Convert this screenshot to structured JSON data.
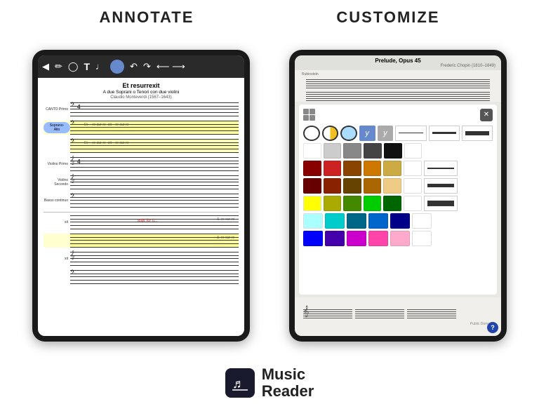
{
  "header": {
    "annotate_label": "ANNOTATE",
    "customize_label": "CUSTOMIZE"
  },
  "left_tablet": {
    "piece_title": "Et resurrexit",
    "piece_subtitle": "A due Soprani o Tenori con due violini",
    "piece_composer": "Claudio Monteverdi (1567–1643)",
    "toolbar_icons": [
      "←",
      "✏",
      "◯",
      "T",
      "♩",
      "●",
      "↶",
      "↷",
      "←→"
    ],
    "staff_rows": [
      {
        "label": "CANTO Primo",
        "highlighted": false,
        "blue_label": false
      },
      {
        "label": "Soprano-Alto",
        "highlighted": true,
        "blue_label": true
      },
      {
        "label": "",
        "highlighted": true,
        "blue_label": false
      },
      {
        "label": "Violino Primo",
        "highlighted": false,
        "blue_label": false
      },
      {
        "label": "Violino Secondo",
        "highlighted": false,
        "blue_label": false
      },
      {
        "label": "Basso continuo",
        "highlighted": false,
        "blue_label": false
      }
    ],
    "bottom_label": "wait for it...",
    "time_sig": "4/2"
  },
  "right_tablet": {
    "piece_title": "Prelude, Opus 45",
    "piece_composer": "Frederic Chopin (1810–1849)",
    "staff_label": "Rubinstein",
    "public_domain_text": "Public Domain",
    "help_text": "?",
    "color_palette": {
      "row1": [
        {
          "type": "circle-half",
          "color1": "#fff",
          "color2": "#fff",
          "border": "#333"
        },
        {
          "type": "circle-half",
          "color1": "#fff",
          "color2": "#f0c020",
          "border": "#333"
        },
        {
          "type": "circle-half",
          "color1": "#aaddff",
          "color2": "#aaddff",
          "border": "#333"
        },
        {
          "type": "y-label",
          "bg": "#6688cc",
          "text": "y"
        },
        {
          "type": "y-label",
          "bg": "#aaaaaa",
          "text": "y"
        },
        {
          "type": "line",
          "thickness": 1
        },
        {
          "type": "line",
          "thickness": 2
        },
        {
          "type": "line",
          "thickness": 4
        }
      ],
      "rows": [
        [
          "#ffffff",
          "#cccccc",
          "#888888",
          "#444444",
          "#111111",
          ""
        ],
        [
          "#ffffff",
          "#cccccc",
          "#666666",
          "#333333",
          "#000000",
          ""
        ],
        [
          "#880000",
          "#aa2222",
          "#884400",
          "#cc7700",
          "#ccaa44",
          ""
        ],
        [
          "#660000",
          "#882200",
          "#664400",
          "#aa6600",
          "#eecc88",
          ""
        ],
        [
          "#ffff00",
          "#aaaa00",
          "#448800",
          "#00cc00",
          "#006600",
          ""
        ],
        [
          "#aaffff",
          "#00cccc",
          "#006688",
          "#0066cc",
          "#000088",
          ""
        ],
        [
          "#0000ff",
          "#4400aa",
          "#cc00cc",
          "#ff44aa",
          "#ffaacc",
          ""
        ]
      ]
    },
    "close_icon": "✕",
    "grid_icon": "⊞"
  },
  "logo": {
    "icon": "🎵",
    "name_top": "Music",
    "name_bottom": "Reader"
  }
}
